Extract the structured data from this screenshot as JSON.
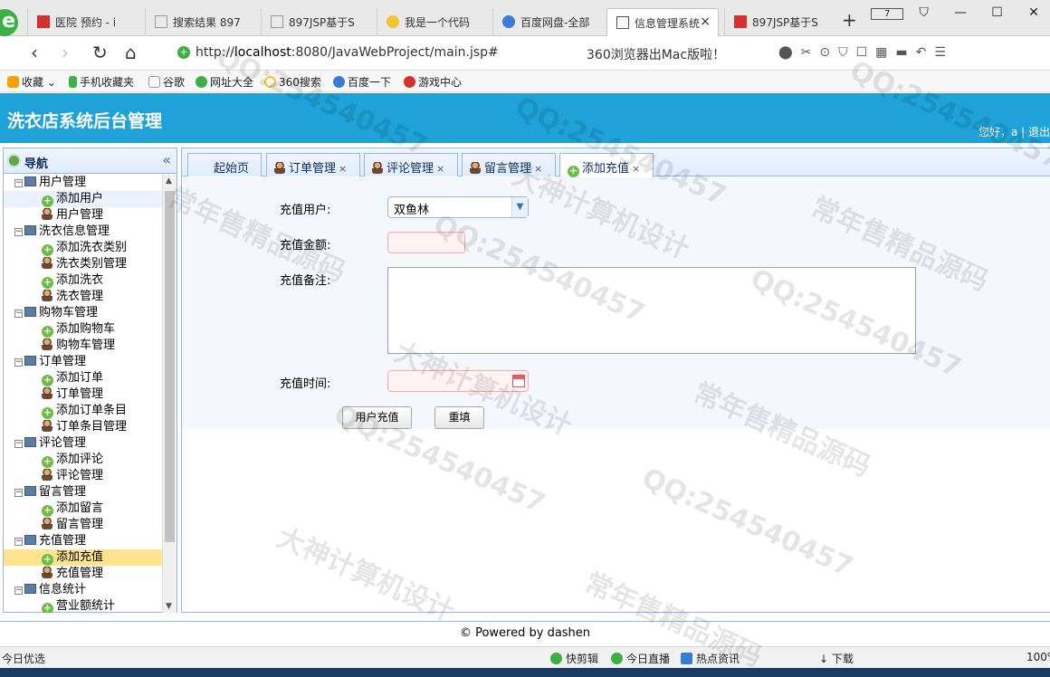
{
  "browser": {
    "tabs": [
      {
        "title": "医院 预约 - i",
        "icon_color": "#d8302c"
      },
      {
        "title": "搜索结果 897",
        "icon_color": "#999999"
      },
      {
        "title": "897JSP基于S",
        "icon_color": "#999999"
      },
      {
        "title": "我是一个代码",
        "icon_color": "#f4c430"
      },
      {
        "title": "百度网盘-全部",
        "icon_color": "#3a7bd5"
      },
      {
        "title": "信息管理系统",
        "icon_color": "#555555",
        "close": "×"
      },
      {
        "title": "897JSP基于S",
        "icon_color": "#d8302c"
      }
    ],
    "new_tab": "+",
    "tab_count": "7",
    "window_controls": [
      "—",
      "☐",
      "✕"
    ],
    "url_scheme": "http://",
    "url_host": "localhost",
    "url_rest": ":8080/JavaWebProject/main.jsp#",
    "promo": "360浏览器出Mac版啦！",
    "bookmarks": [
      {
        "label": "收藏",
        "color": "#f4a300"
      },
      {
        "label": "手机收藏夹",
        "color": "#3cb043"
      },
      {
        "label": "谷歌",
        "color": "#999999"
      },
      {
        "label": "网址大全",
        "color": "#3cb043"
      },
      {
        "label": "360搜索",
        "color": "#f4c430"
      },
      {
        "label": "百度一下",
        "color": "#3a7bd5"
      },
      {
        "label": "游戏中心",
        "color": "#d8302c"
      }
    ]
  },
  "app": {
    "title": "洗衣店系统后台管理",
    "greeting": "您好，a |",
    "logout": "退出"
  },
  "sidebar": {
    "title": "导航",
    "collapse": "«",
    "groups": [
      {
        "label": "用户管理",
        "items": [
          "添加用户",
          "用户管理"
        ]
      },
      {
        "label": "洗衣信息管理",
        "items": [
          "添加洗衣类别",
          "洗衣类别管理",
          "添加洗衣",
          "洗衣管理"
        ]
      },
      {
        "label": "购物车管理",
        "items": [
          "添加购物车",
          "购物车管理"
        ]
      },
      {
        "label": "订单管理",
        "items": [
          "添加订单",
          "订单管理",
          "添加订单条目",
          "订单条目管理"
        ]
      },
      {
        "label": "评论管理",
        "items": [
          "添加评论",
          "评论管理"
        ]
      },
      {
        "label": "留言管理",
        "items": [
          "添加留言",
          "留言管理"
        ]
      },
      {
        "label": "充值管理",
        "items": [
          "添加充值",
          "充值管理"
        ]
      },
      {
        "label": "信息统计",
        "items": [
          "营业额统计"
        ]
      }
    ]
  },
  "tabs": [
    {
      "label": "起始页"
    },
    {
      "label": "订单管理"
    },
    {
      "label": "评论管理"
    },
    {
      "label": "留言管理"
    },
    {
      "label": "添加充值"
    }
  ],
  "form": {
    "user_label": "充值用户:",
    "user_value": "双鱼林",
    "amount_label": "充值金额:",
    "remark_label": "充值备注:",
    "time_label": "充值时间:",
    "submit": "用户充值",
    "reset": "重填"
  },
  "footer": "© Powered by dashen",
  "status": {
    "left": "今日优选",
    "items": [
      "快剪辑",
      "今日直播",
      "热点资讯",
      "下载"
    ],
    "zoom": "100%"
  },
  "watermarks": [
    "QQ:254540457",
    "常年售精品源码",
    "大神计算机设计"
  ]
}
